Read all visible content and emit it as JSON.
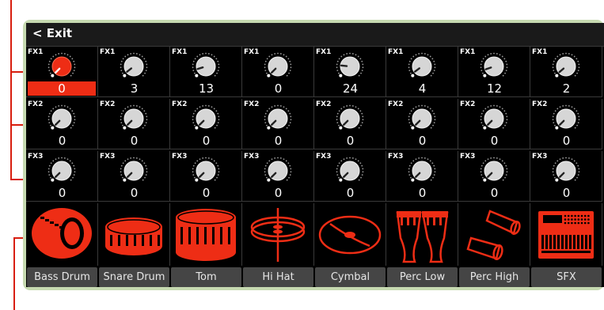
{
  "header": {
    "exit_label": "< Exit"
  },
  "accent_color": "#ee2d15",
  "selected_cell": {
    "row": 0,
    "col": 0
  },
  "effect_rows": [
    {
      "label": "FX1",
      "values": [
        "0",
        "3",
        "13",
        "0",
        "24",
        "4",
        "12",
        "2"
      ]
    },
    {
      "label": "FX2",
      "values": [
        "0",
        "0",
        "0",
        "0",
        "0",
        "0",
        "0",
        "0"
      ]
    },
    {
      "label": "FX3",
      "values": [
        "0",
        "0",
        "0",
        "0",
        "0",
        "0",
        "0",
        "0"
      ]
    }
  ],
  "drum_families": [
    {
      "name": "Bass Drum",
      "icon": "bass-drum-icon"
    },
    {
      "name": "Snare Drum",
      "icon": "snare-drum-icon"
    },
    {
      "name": "Tom",
      "icon": "tom-icon"
    },
    {
      "name": "Hi Hat",
      "icon": "hi-hat-icon"
    },
    {
      "name": "Cymbal",
      "icon": "cymbal-icon"
    },
    {
      "name": "Perc Low",
      "icon": "perc-low-icon"
    },
    {
      "name": "Perc High",
      "icon": "perc-high-icon"
    },
    {
      "name": "SFX",
      "icon": "sfx-icon"
    }
  ]
}
